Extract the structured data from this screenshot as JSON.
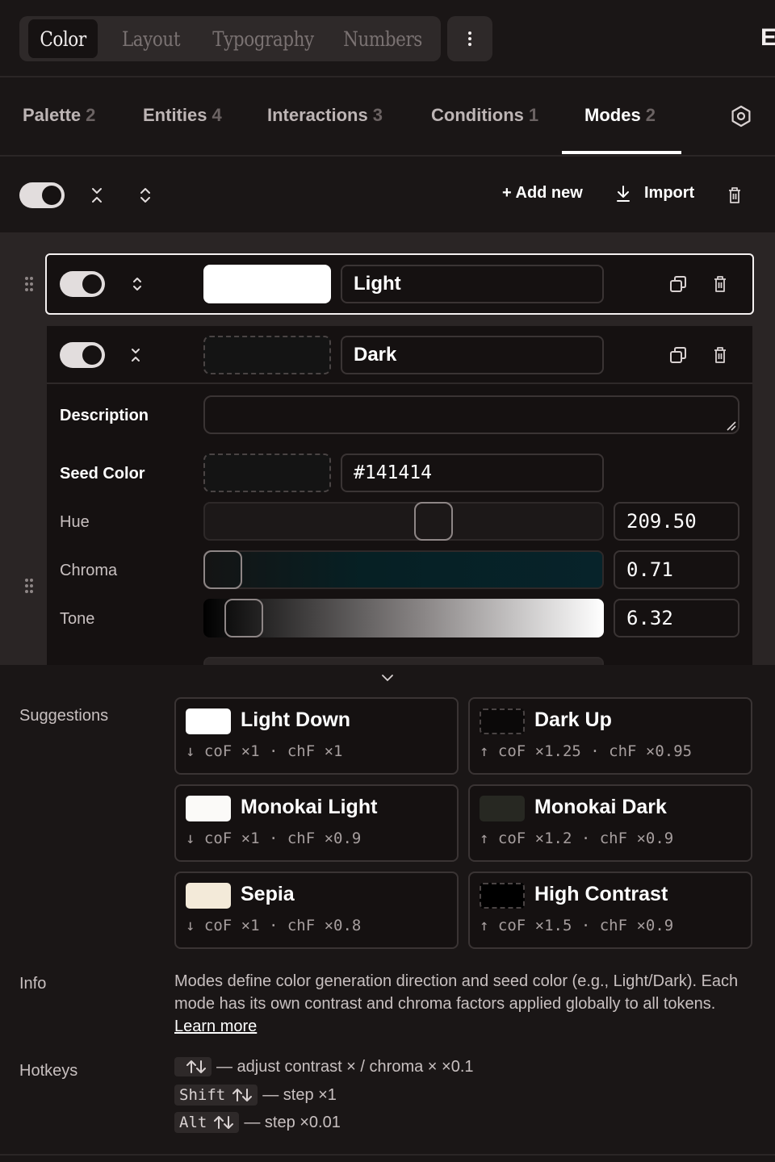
{
  "segmented": {
    "items": [
      {
        "label": "Color",
        "active": true
      },
      {
        "label": "Layout",
        "active": false
      },
      {
        "label": "Typography",
        "active": false
      },
      {
        "label": "Numbers",
        "active": false
      }
    ],
    "more_icon": "kebab-icon",
    "edge_label": "E"
  },
  "tabs": [
    {
      "label": "Palette",
      "count": "2"
    },
    {
      "label": "Entities",
      "count": "4"
    },
    {
      "label": "Interactions",
      "count": "3"
    },
    {
      "label": "Conditions",
      "count": "1"
    },
    {
      "label": "Modes",
      "count": "2",
      "active": true
    }
  ],
  "toolbar": {
    "add_label": "+ Add new",
    "import_label": "Import"
  },
  "modes": [
    {
      "name": "Light",
      "swatch": "#ffffff",
      "enabled": true,
      "collapsed": true
    },
    {
      "name": "Dark",
      "swatch": "#141414",
      "enabled": true,
      "collapsed": false
    }
  ],
  "dark_mode": {
    "description_label": "Description",
    "description_value": "",
    "seed_label": "Seed Color",
    "seed_value": "#141414",
    "hue_label": "Hue",
    "hue_value": "209.50",
    "hue_fraction": 0.582,
    "chroma_label": "Chroma",
    "chroma_value": "0.71",
    "chroma_fraction": 0.0,
    "tone_label": "Tone",
    "tone_value": "6.32",
    "tone_fraction": 0.063
  },
  "suggestions": {
    "label": "Suggestions",
    "items": [
      {
        "title": "Light Down",
        "meta": "↓ coF ×1 · chF ×1",
        "swatch": "#ffffff",
        "dashed": false
      },
      {
        "title": "Dark Up",
        "meta": "↑ coF ×1.25 · chF ×0.95",
        "swatch": "#0b0909",
        "dashed": true
      },
      {
        "title": "Monokai Light",
        "meta": "↓ coF ×1 · chF ×0.9",
        "swatch": "#fbfaf8",
        "dashed": false
      },
      {
        "title": "Monokai Dark",
        "meta": "↑ coF ×1.2 · chF ×0.9",
        "swatch": "#272822",
        "dashed": false
      },
      {
        "title": "Sepia",
        "meta": "↓ coF ×1 · chF ×0.8",
        "swatch": "#f3ead9",
        "dashed": false
      },
      {
        "title": "High Contrast",
        "meta": "↑ coF ×1.5 · chF ×0.9",
        "swatch": "#000000",
        "dashed": true
      }
    ]
  },
  "info": {
    "label": "Info",
    "text": "Modes define color generation direction and seed color (e.g., Light/Dark). Each mode has its own contrast and chroma factors applied globally to all tokens.",
    "link": "Learn more"
  },
  "hotkeys": {
    "label": "Hotkeys",
    "items": [
      {
        "key": "",
        "text": "— adjust contrast × / chroma × ×0.1"
      },
      {
        "key": "Shift",
        "text": "— step ×1"
      },
      {
        "key": "Alt",
        "text": "— step ×0.01"
      }
    ]
  }
}
